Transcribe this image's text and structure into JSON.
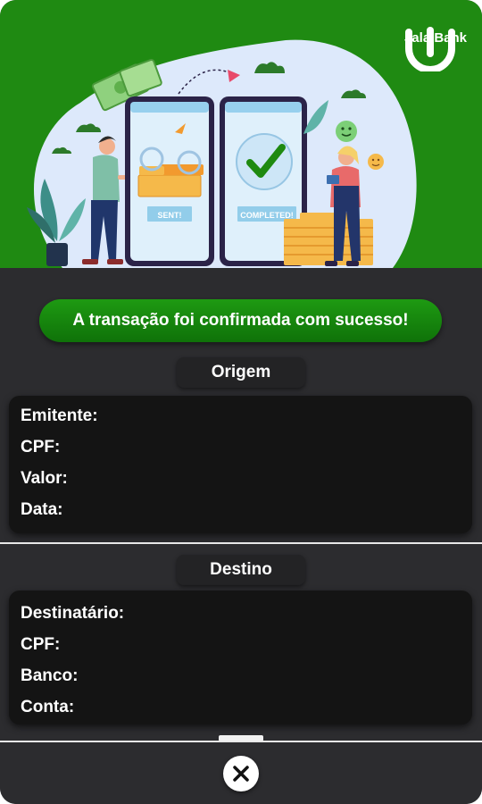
{
  "brand": {
    "name": "Jala Bank",
    "color": "#1f8a12"
  },
  "illustration": {
    "left_phone_badge": "SENT!",
    "right_phone_badge": "COMPLETED!"
  },
  "banner": {
    "message": "A transação foi confirmada com sucesso!"
  },
  "origin": {
    "title": "Origem",
    "fields": [
      "Emitente:",
      "CPF:",
      "Valor:",
      "Data:"
    ]
  },
  "destination": {
    "title": "Destino",
    "fields": [
      "Destinatário:",
      "CPF:",
      "Banco:",
      "Conta:"
    ]
  },
  "actions": {
    "close_icon": "close-icon"
  }
}
